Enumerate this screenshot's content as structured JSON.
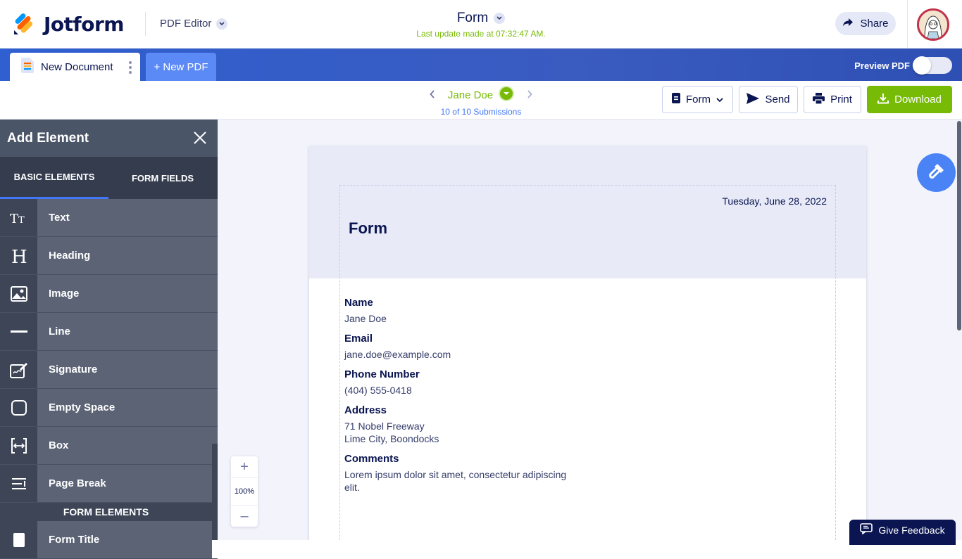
{
  "header": {
    "brand": "Jotform",
    "app_name": "PDF Editor",
    "doc_title": "Form",
    "last_update": "Last update made at 07:32:47 AM.",
    "share_label": "Share"
  },
  "tabs": {
    "document_tab": "New Document",
    "new_pdf": "+ New PDF",
    "preview_label": "Preview PDF",
    "preview_on": false
  },
  "toolbar": {
    "submission_name": "Jane Doe",
    "submission_count": "10 of 10 Submissions",
    "form_label": "Form",
    "send_label": "Send",
    "print_label": "Print",
    "download_label": "Download"
  },
  "sidebar": {
    "title": "Add Element",
    "tab_basic": "BASIC ELEMENTS",
    "tab_fields": "FORM FIELDS",
    "items": [
      {
        "label": "Text",
        "icon": "text-icon"
      },
      {
        "label": "Heading",
        "icon": "heading-icon"
      },
      {
        "label": "Image",
        "icon": "image-icon"
      },
      {
        "label": "Line",
        "icon": "line-icon"
      },
      {
        "label": "Signature",
        "icon": "signature-icon"
      },
      {
        "label": "Empty Space",
        "icon": "empty-space-icon"
      },
      {
        "label": "Box",
        "icon": "box-icon"
      },
      {
        "label": "Page Break",
        "icon": "page-break-icon"
      }
    ],
    "section_form": "FORM ELEMENTS",
    "next_item": "Form Title"
  },
  "document": {
    "date": "Tuesday, June 28, 2022",
    "title": "Form",
    "fields": [
      {
        "label": "Name",
        "value": "Jane Doe"
      },
      {
        "label": "Email",
        "value": "jane.doe@example.com"
      },
      {
        "label": "Phone Number",
        "value": "(404) 555-0418"
      },
      {
        "label": "Address",
        "value_line1": "71 Nobel Freeway",
        "value_line2": "Lime City, Boondocks"
      },
      {
        "label": "Comments",
        "value_line1": "Lorem ipsum dolor sit amet, consectetur adipiscing",
        "value_line2": "elit."
      }
    ]
  },
  "zoom": {
    "plus": "+",
    "level": "100%",
    "minus": "–"
  },
  "feedback_label": "Give Feedback",
  "colors": {
    "accent_blue": "#4277f7",
    "brand_green": "#78bb07",
    "navy": "#0a1551"
  }
}
